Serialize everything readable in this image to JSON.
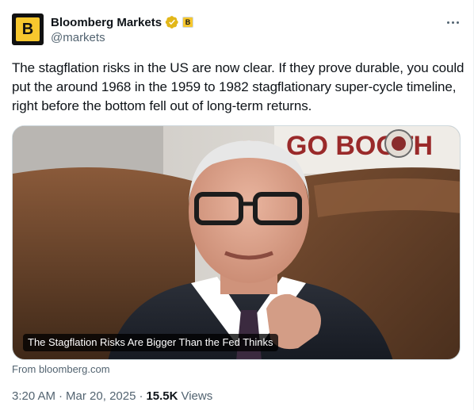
{
  "author": {
    "display_name": "Bloomberg Markets",
    "handle": "@markets",
    "avatar_letter": "B",
    "affiliate_letter": "B",
    "verified_badge": "gold-verified-icon",
    "brand_color": "#f7c72e"
  },
  "tweet": {
    "text": "The stagflation risks in the US are now clear. If they prove durable, you could put the around 1968 in the 1959 to 1982 stagflationary super-cycle timeline, right before the bottom fell out of long-term returns."
  },
  "card": {
    "backdrop_text": "GO BOOTH",
    "caption": "The Stagflation Risks Are Bigger Than the Fed Thinks",
    "source": "From bloomberg.com"
  },
  "meta": {
    "time": "3:20 AM",
    "date": "Mar 20, 2025",
    "separator": "·",
    "views_count": "15.5K",
    "views_label": "Views"
  },
  "icons": {
    "more": "more-horizontal-icon"
  }
}
